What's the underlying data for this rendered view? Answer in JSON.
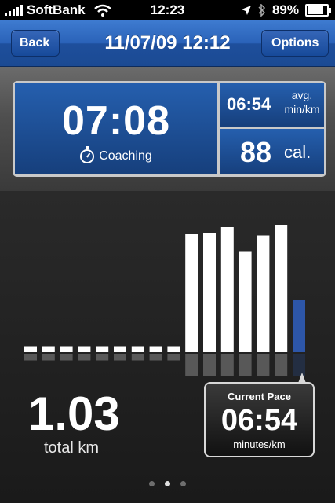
{
  "status_bar": {
    "carrier": "SoftBank",
    "time": "12:23",
    "battery": "89%",
    "battery_level": 0.89
  },
  "nav": {
    "back_label": "Back",
    "title": "11/07/09 12:12",
    "options_label": "Options"
  },
  "stats": {
    "elapsed_time": "07:08",
    "coaching_label": "Coaching",
    "avg_pace": "06:54",
    "avg_pace_label": "avg.",
    "avg_pace_unit": "min/km",
    "calories": "88",
    "calories_unit": "cal."
  },
  "chart_data": {
    "type": "bar",
    "values": [
      0.05,
      0.05,
      0.05,
      0.05,
      0.05,
      0.05,
      0.05,
      0.05,
      0.05,
      1.0,
      1.01,
      1.06,
      0.85,
      0.99,
      1.08,
      0.44
    ],
    "highlight_index": 15,
    "colors": {
      "bar": "#ffffff",
      "current": "#2d56a8"
    }
  },
  "summary": {
    "distance": "1.03",
    "distance_unit": "total km"
  },
  "current_pace": {
    "label": "Current Pace",
    "value": "06:54",
    "unit": "minutes/km"
  },
  "pager": {
    "count": 3,
    "active": 1
  }
}
